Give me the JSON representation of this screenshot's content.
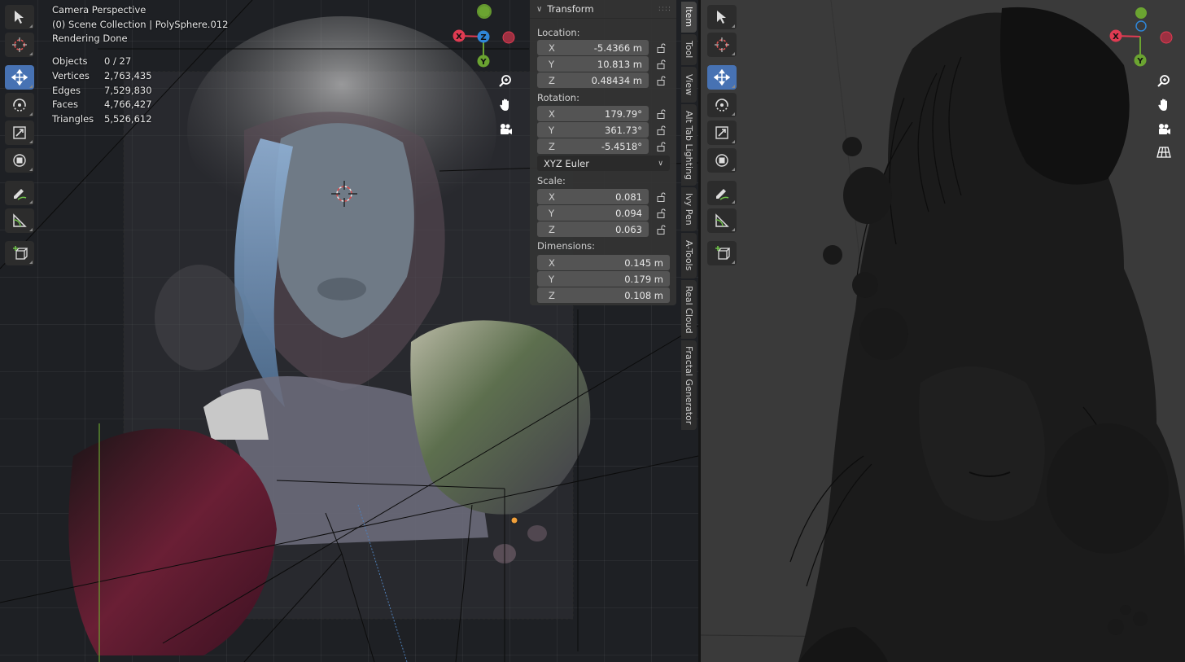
{
  "overlay": {
    "view_name": "Camera Perspective",
    "collection": "(0) Scene Collection | PolySphere.012",
    "render_status": "Rendering Done",
    "stats": [
      {
        "label": "Objects",
        "value": "0 / 27"
      },
      {
        "label": "Vertices",
        "value": "2,763,435"
      },
      {
        "label": "Edges",
        "value": "7,529,830"
      },
      {
        "label": "Faces",
        "value": "4,766,427"
      },
      {
        "label": "Triangles",
        "value": "5,526,612"
      }
    ]
  },
  "toolbar": {
    "tools": [
      {
        "name": "select-box-tool",
        "icon": "select-cursor-icon",
        "active": false
      },
      {
        "name": "cursor-tool",
        "icon": "3d-cursor-icon",
        "active": false
      },
      {
        "name": "move-tool",
        "icon": "move-arrows-icon",
        "active": true
      },
      {
        "name": "rotate-tool",
        "icon": "rotate-icon",
        "active": false
      },
      {
        "name": "scale-tool",
        "icon": "scale-icon",
        "active": false
      },
      {
        "name": "transform-tool",
        "icon": "transform-icon",
        "active": false
      },
      {
        "name": "annotate-tool",
        "icon": "annotate-pencil-icon",
        "active": false
      },
      {
        "name": "measure-tool",
        "icon": "ruler-icon",
        "active": false
      },
      {
        "name": "add-cube-tool",
        "icon": "add-cube-icon",
        "active": false
      }
    ]
  },
  "gizmo": {
    "x_label": "X",
    "y_label": "Y",
    "z_label": "Z",
    "colors": {
      "x": "#e03b52",
      "y": "#6ba431",
      "z": "#2f86d8"
    }
  },
  "transform_panel": {
    "title": "Transform",
    "location": {
      "label": "Location:",
      "x": {
        "axis": "X",
        "value": "-5.4366 m"
      },
      "y": {
        "axis": "Y",
        "value": "10.813 m"
      },
      "z": {
        "axis": "Z",
        "value": "0.48434 m"
      }
    },
    "rotation": {
      "label": "Rotation:",
      "x": {
        "axis": "X",
        "value": "179.79°"
      },
      "y": {
        "axis": "Y",
        "value": "361.73°"
      },
      "z": {
        "axis": "Z",
        "value": "-5.4518°"
      }
    },
    "rotation_mode": "XYZ Euler",
    "scale": {
      "label": "Scale:",
      "x": {
        "axis": "X",
        "value": "0.081"
      },
      "y": {
        "axis": "Y",
        "value": "0.094"
      },
      "z": {
        "axis": "Z",
        "value": "0.063"
      }
    },
    "dimensions": {
      "label": "Dimensions:",
      "x": {
        "axis": "X",
        "value": "0.145 m"
      },
      "y": {
        "axis": "Y",
        "value": "0.179 m"
      },
      "z": {
        "axis": "Z",
        "value": "0.108 m"
      }
    }
  },
  "sidebar_tabs": [
    {
      "label": "Item",
      "active": true
    },
    {
      "label": "Tool",
      "active": false
    },
    {
      "label": "View",
      "active": false
    },
    {
      "label": "Alt Tab Lighting",
      "active": false
    },
    {
      "label": "Ivy Pen",
      "active": false
    },
    {
      "label": "A-Tools",
      "active": false
    },
    {
      "label": "Real Cloud",
      "active": false
    },
    {
      "label": "Fractal Generator",
      "active": false
    }
  ],
  "accent_color": "#4772b3"
}
